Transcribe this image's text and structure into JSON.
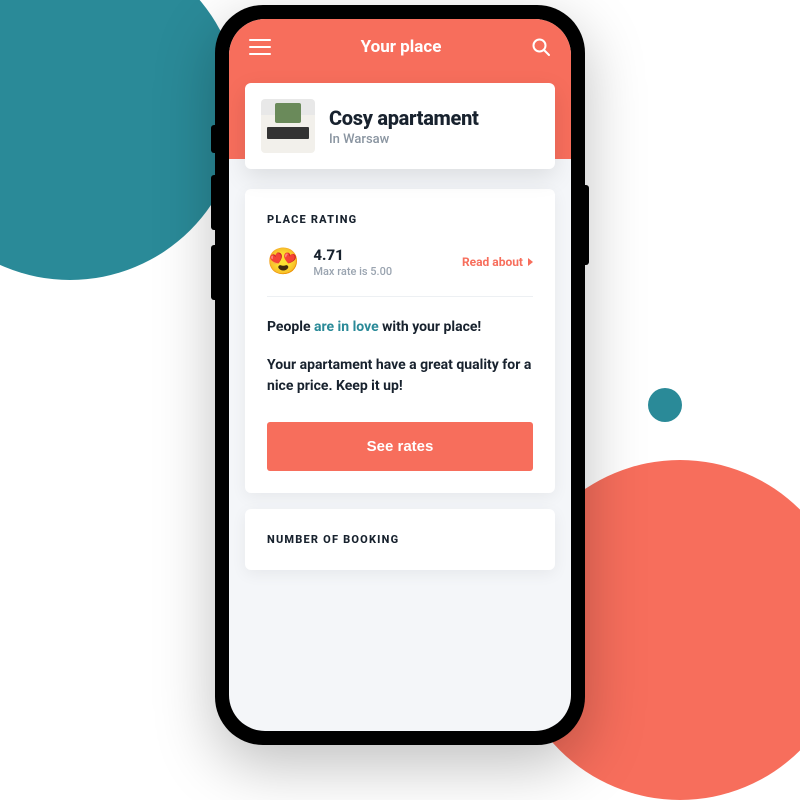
{
  "header": {
    "title": "Your place"
  },
  "place": {
    "name": "Cosy apartament",
    "location": "In Warsaw"
  },
  "rating": {
    "section_label": "PLACE RATING",
    "emoji": "😍",
    "value": "4.71",
    "max_text": "Max rate is 5.00",
    "read_about": "Read about",
    "desc_prefix": "People ",
    "desc_highlight": "are in love",
    "desc_suffix": " with your place!",
    "desc_line2": "Your apartament have a great quality for a nice price. Keep it up!",
    "button": "See rates"
  },
  "booking": {
    "section_label": "NUMBER OF BOOKING"
  },
  "colors": {
    "accent": "#f76e5c",
    "teal": "#2a8a98",
    "dark": "#18222e"
  }
}
